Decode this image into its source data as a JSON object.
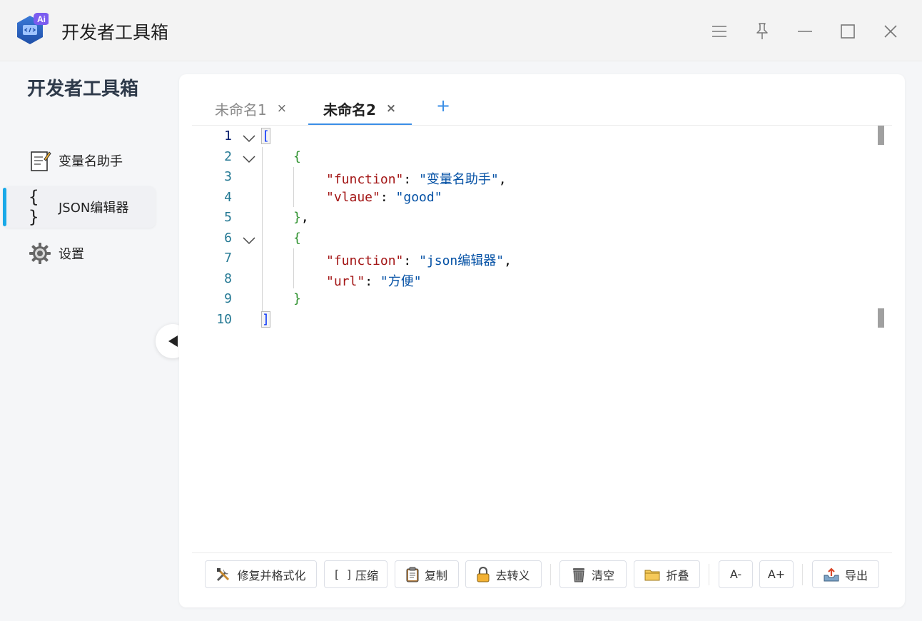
{
  "app": {
    "title": "开发者工具箱",
    "logo_badge": "Ai"
  },
  "window_controls": [
    "menu-icon",
    "pin-icon",
    "minimize-icon",
    "maximize-icon",
    "close-icon"
  ],
  "sidebar": {
    "heading": "开发者工具箱",
    "items": [
      {
        "label": "变量名助手",
        "icon": "memo-icon",
        "active": false
      },
      {
        "label": "JSON编辑器",
        "icon": "braces-icon",
        "active": true
      },
      {
        "label": "设置",
        "icon": "gear-icon",
        "active": false
      }
    ],
    "collapse_icon": "triangle-left-icon"
  },
  "tabs": [
    {
      "label": "未命名1",
      "close": "×",
      "active": false
    },
    {
      "label": "未命名2",
      "close": "×",
      "active": true
    }
  ],
  "tab_add": "+",
  "editor": {
    "line_numbers": [
      "1",
      "2",
      "3",
      "4",
      "5",
      "6",
      "7",
      "8",
      "9",
      "10"
    ],
    "code": {
      "l1": {
        "open": "["
      },
      "l2": {
        "open": "{"
      },
      "l3": {
        "key": "\"function\"",
        "colon": ": ",
        "value": "\"变量名助手\"",
        "comma": ","
      },
      "l4": {
        "key": "\"vlaue\"",
        "colon": ": ",
        "value": "\"good\""
      },
      "l5": {
        "close": "}",
        "comma": ","
      },
      "l6": {
        "open": "{"
      },
      "l7": {
        "key": "\"function\"",
        "colon": ": ",
        "value": "\"json编辑器\"",
        "comma": ","
      },
      "l8": {
        "key": "\"url\"",
        "colon": ": ",
        "value": "\"方便\""
      },
      "l9": {
        "close": "}"
      },
      "l10": {
        "close": "]"
      }
    }
  },
  "toolbar": {
    "repair_format": "修复并格式化",
    "compress": "压缩",
    "compress_icon_text": "[ ]",
    "copy": "复制",
    "unescape": "去转义",
    "clear": "清空",
    "fold": "折叠",
    "font_smaller": "A-",
    "font_larger": "A+",
    "export": "导出"
  },
  "colors": {
    "accent": "#3a8ee6",
    "active_indicator": "#19a9e8",
    "json_key": "#a31515",
    "json_string": "#0451a5",
    "bracket_level1": "#0431fa",
    "bracket_level2": "#319331"
  }
}
